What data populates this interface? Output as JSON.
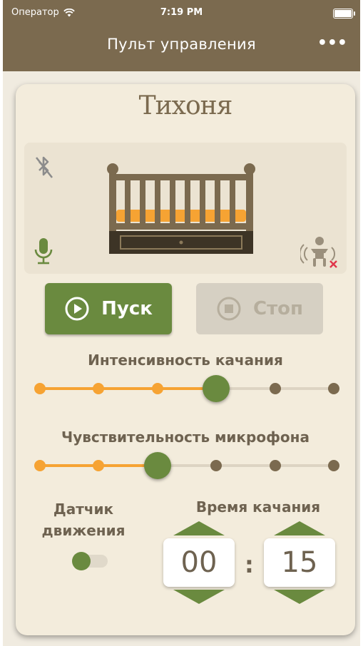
{
  "status_bar": {
    "carrier": "Оператор",
    "time": "7:19 PM"
  },
  "nav": {
    "title": "Пульт управления",
    "more_label": "•••"
  },
  "brand": "Тихоня",
  "controls": {
    "start_label": "Пуск",
    "stop_label": "Стоп"
  },
  "intensity": {
    "label": "Интенсивность качания",
    "steps": 6,
    "selected": 4
  },
  "sensitivity": {
    "label": "Чувствительность микрофона",
    "steps": 6,
    "selected": 3
  },
  "motion_sensor": {
    "label_line1": "Датчик",
    "label_line2": "движения",
    "enabled": false
  },
  "rocking_time": {
    "label": "Время качания",
    "minutes": "00",
    "seconds": "15",
    "separator": ":"
  },
  "colors": {
    "header": "#7b6a4f",
    "accent_green": "#6a8a3f",
    "accent_orange": "#f6a333",
    "card": "#f3ecdc"
  },
  "icons": {
    "wifi": "wifi-icon",
    "battery": "battery-icon",
    "bluetooth_off": "bluetooth-off-icon",
    "microphone": "microphone-icon",
    "motion_sensor_off": "motion-sensor-off-icon",
    "play": "play-icon",
    "stop": "stop-icon"
  }
}
